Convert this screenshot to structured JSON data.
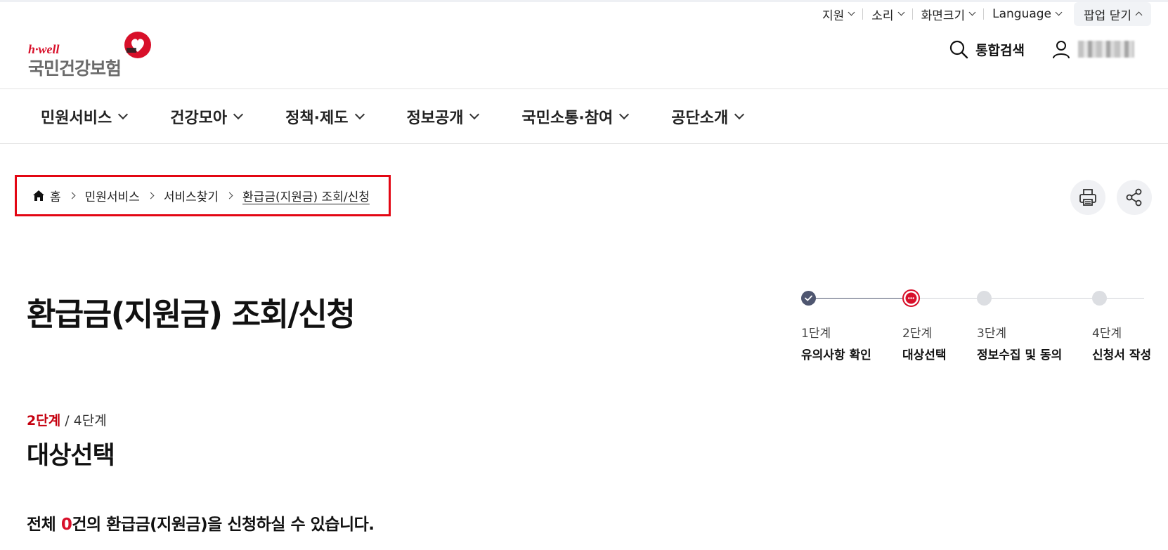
{
  "utility": {
    "items": [
      "지원",
      "소리",
      "화면크기",
      "Language"
    ],
    "popup_close": "팝업 닫기"
  },
  "logo": {
    "sub": "h·well",
    "main": "국민건강보험"
  },
  "header": {
    "search_label": "통합검색"
  },
  "gnb": {
    "items": [
      "민원서비스",
      "건강모아",
      "정책·제도",
      "정보공개",
      "국민소통·참여",
      "공단소개"
    ]
  },
  "breadcrumb": {
    "home": "홈",
    "items": [
      "민원서비스",
      "서비스찾기",
      "환급금(지원금) 조회/신청"
    ]
  },
  "page": {
    "title": "환급금(지원금) 조회/신청"
  },
  "stepper": {
    "steps": [
      {
        "num": "1단계",
        "name": "유의사항 확인",
        "state": "done"
      },
      {
        "num": "2단계",
        "name": "대상선택",
        "state": "current"
      },
      {
        "num": "3단계",
        "name": "정보수집 및 동의",
        "state": "pending"
      },
      {
        "num": "4단계",
        "name": "신청서 작성",
        "state": "pending"
      }
    ]
  },
  "section": {
    "step_current": "2단계",
    "step_total": "/ 4단계",
    "title": "대상선택",
    "summary_prefix": "전체 ",
    "summary_count": "0",
    "summary_suffix": "건의 환급금(지원금)을 신청하실 수 있습니다."
  },
  "colors": {
    "brand_red": "#d8102a",
    "highlight_box": "#e30613",
    "step_done": "#4f5670"
  },
  "icons": [
    "home-icon",
    "print-icon",
    "share-icon",
    "search-icon",
    "user-icon",
    "heart-logo-icon"
  ]
}
